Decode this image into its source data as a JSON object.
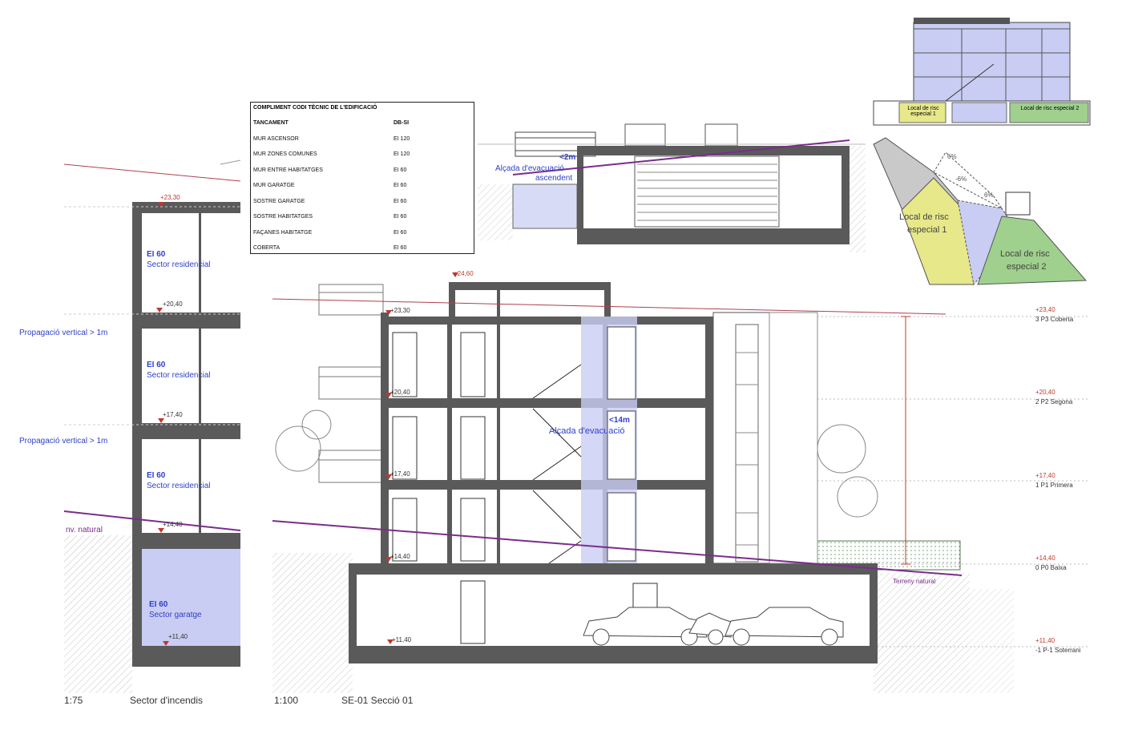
{
  "table": {
    "title": "COMPLIMENT CODI TÈCNIC DE L'EDIFICACIÓ",
    "col1_header": "TANCAMENT",
    "col2_header": "DB-SI",
    "rows": [
      {
        "name": "MUR ASCENSOR",
        "value": "EI 120"
      },
      {
        "name": "MUR ZONES COMUNES",
        "value": "EI 120"
      },
      {
        "name": "MUR ENTRE HABITATGES",
        "value": "EI 60"
      },
      {
        "name": "MUR GARATGE",
        "value": "EI 60"
      },
      {
        "name": "SOSTRE GARATGE",
        "value": "EI 60"
      },
      {
        "name": "SOSTRE HABITATGES",
        "value": "EI 60"
      },
      {
        "name": "FAÇANES HABITATGE",
        "value": "EI 60"
      },
      {
        "name": "COBERTA",
        "value": "EI 60"
      }
    ]
  },
  "left_section": {
    "top_level": "+23,30",
    "sectors": [
      {
        "rating": "EI 60",
        "name": "Sector residencial"
      },
      {
        "rating": "EI 60",
        "name": "Sector residencial"
      },
      {
        "rating": "EI 60",
        "name": "Sector residencial"
      },
      {
        "rating": "EI 60",
        "name": "Sector garatge"
      }
    ],
    "levels": [
      "+20,40",
      "+17,40",
      "+14,40",
      "+11,40"
    ],
    "propagation_1": "Propagació vertical > 1m",
    "propagation_2": "Propagació vertical > 1m",
    "terrain": "nv. natural",
    "scale": "1:75",
    "caption": "Sector d'incendis"
  },
  "main_section": {
    "top_level": "+24,60",
    "roof_level": "+23,30",
    "evac_height_label": "Alçada d'evacuació",
    "evac_height_value": "<14m",
    "terrain": "Terreny natural",
    "scale": "1:100",
    "caption": "SE-01 Secció 01",
    "floor_levels": [
      {
        "level": "+23,40",
        "name": "3 P3 Coberta"
      },
      {
        "level": "+20,40",
        "name": "2 P2 Segona"
      },
      {
        "level": "+17,40",
        "name": "1 P1 Primera"
      },
      {
        "level": "+14,40",
        "name": "0 P0 Baixa"
      },
      {
        "level": "+11,40",
        "name": "-1 P-1 Soterrani"
      }
    ],
    "inner_levels": [
      "+20,40",
      "+17,40",
      "+14,40",
      "+11,40"
    ]
  },
  "top_center": {
    "evac_value": "<2m",
    "evac_label_1": "Alçada d'evacuació",
    "evac_label_2": "ascendent"
  },
  "top_right": {
    "zone_1": "Local de risc especial 1",
    "zone_2": "Local de risc especial 2"
  },
  "plan_right": {
    "zone_1_line1": "Local de risc",
    "zone_1_line2": "especial 1",
    "zone_2_line1": "Local de risc",
    "zone_2_line2": "especial 2",
    "slope_1": "6%",
    "slope_2": "-6%",
    "slope_3": "6%"
  },
  "colors": {
    "residential": "#ffffff",
    "garage_fill": "#c9cdf3",
    "purple_line": "#7b2c8c",
    "structure": "#5a5a5a",
    "zone1_fill": "#e6e88a",
    "zone2_fill": "#9fd08d",
    "label_blue": "#2f3fc9"
  }
}
